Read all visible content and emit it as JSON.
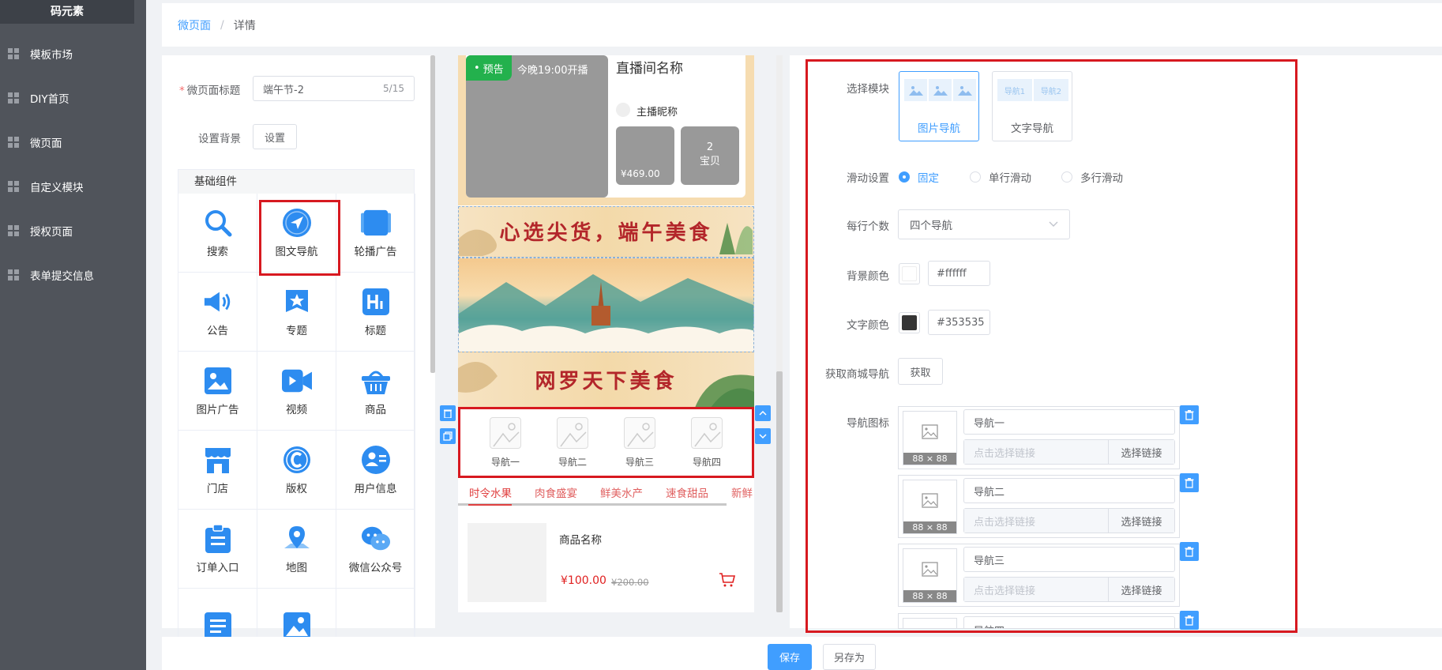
{
  "sidebar": {
    "logo": "码元素",
    "items": [
      {
        "label": "模板市场"
      },
      {
        "label": "DIY首页"
      },
      {
        "label": "微页面"
      },
      {
        "label": "自定义模块"
      },
      {
        "label": "授权页面"
      },
      {
        "label": "表单提交信息"
      }
    ]
  },
  "breadcrumb": {
    "parent": "微页面",
    "separator": "/",
    "current": "详情"
  },
  "page_settings": {
    "title_label": "微页面标题",
    "title_value": "端午节-2",
    "title_count": "5/15",
    "bg_label": "设置背景",
    "bg_button": "设置"
  },
  "components": {
    "header": "基础组件",
    "items": [
      {
        "label": "搜索",
        "icon": "search-icon",
        "color": "#2d8cf0"
      },
      {
        "label": "图文导航",
        "icon": "navigation-icon",
        "color": "#2d8cf0"
      },
      {
        "label": "轮播广告",
        "icon": "carousel-icon",
        "color": "#2d8cf0"
      },
      {
        "label": "公告",
        "icon": "megaphone-icon",
        "color": "#2d8cf0"
      },
      {
        "label": "专题",
        "icon": "star-badge-icon",
        "color": "#2d8cf0"
      },
      {
        "label": "标题",
        "icon": "heading-icon",
        "color": "#2d8cf0"
      },
      {
        "label": "图片广告",
        "icon": "image-icon",
        "color": "#2d8cf0"
      },
      {
        "label": "视频",
        "icon": "video-icon",
        "color": "#2d8cf0"
      },
      {
        "label": "商品",
        "icon": "basket-icon",
        "color": "#2d8cf0"
      },
      {
        "label": "门店",
        "icon": "store-icon",
        "color": "#2d8cf0"
      },
      {
        "label": "版权",
        "icon": "copyright-icon",
        "color": "#2d8cf0"
      },
      {
        "label": "用户信息",
        "icon": "user-info-icon",
        "color": "#2d8cf0"
      },
      {
        "label": "订单入口",
        "icon": "clipboard-icon",
        "color": "#2d8cf0"
      },
      {
        "label": "地图",
        "icon": "map-pin-icon",
        "color": "#2d8cf0"
      },
      {
        "label": "微信公众号",
        "icon": "wechat-icon",
        "color": "#2d8cf0"
      },
      {
        "label": "",
        "icon": "document-icon",
        "color": "#2d8cf0"
      },
      {
        "label": "",
        "icon": "picture-icon",
        "color": "#2d8cf0"
      }
    ]
  },
  "preview": {
    "live": {
      "tag": "预告",
      "time": "今晚19:00开播",
      "room_name": "直播间名称",
      "anchor": "主播昵称",
      "price": "¥469.00",
      "count": "2",
      "count_label": "宝贝"
    },
    "banners": [
      {
        "text": "心选尖货，端午美食"
      },
      {
        "text": ""
      },
      {
        "text": "网罗天下美食"
      }
    ],
    "nav_items": [
      {
        "label": "导航一"
      },
      {
        "label": "导航二"
      },
      {
        "label": "导航三"
      },
      {
        "label": "导航四"
      }
    ],
    "tabs": [
      {
        "label": "时令水果"
      },
      {
        "label": "肉食盛宴"
      },
      {
        "label": "鲜美水产"
      },
      {
        "label": "速食甜品"
      },
      {
        "label": "新鲜"
      }
    ],
    "product": {
      "name": "商品名称",
      "price": "¥100.00",
      "old_price": "¥200.00"
    }
  },
  "config": {
    "module_label": "选择模块",
    "modules": [
      {
        "label": "图片导航",
        "selected": true
      },
      {
        "label": "文字导航",
        "selected": false,
        "thumbs": [
          "导航1",
          "导航2"
        ]
      }
    ],
    "scroll_label": "滑动设置",
    "scroll_options": [
      {
        "label": "固定",
        "checked": true
      },
      {
        "label": "单行滑动",
        "checked": false
      },
      {
        "label": "多行滑动",
        "checked": false
      }
    ],
    "per_row_label": "每行个数",
    "per_row_value": "四个导航",
    "bg_color_label": "背景颜色",
    "bg_color": "#ffffff",
    "text_color_label": "文字颜色",
    "text_color": "#353535",
    "fetch_label": "获取商城导航",
    "fetch_button": "获取",
    "nav_icon_label": "导航图标",
    "nav_entries": [
      {
        "name": "导航一",
        "size": "88 × 88",
        "link_placeholder": "点击选择链接",
        "link_button": "选择链接"
      },
      {
        "name": "导航二",
        "size": "88 × 88",
        "link_placeholder": "点击选择链接",
        "link_button": "选择链接"
      },
      {
        "name": "导航三",
        "size": "88 × 88",
        "link_placeholder": "点击选择链接",
        "link_button": "选择链接"
      },
      {
        "name": "导航四",
        "size": "",
        "link_placeholder": "",
        "link_button": ""
      }
    ]
  },
  "footer": {
    "save": "保存",
    "save_as": "另存为"
  },
  "colors": {
    "accent": "#409eff",
    "highlight": "#d71920",
    "sidebar": "#50545b"
  }
}
